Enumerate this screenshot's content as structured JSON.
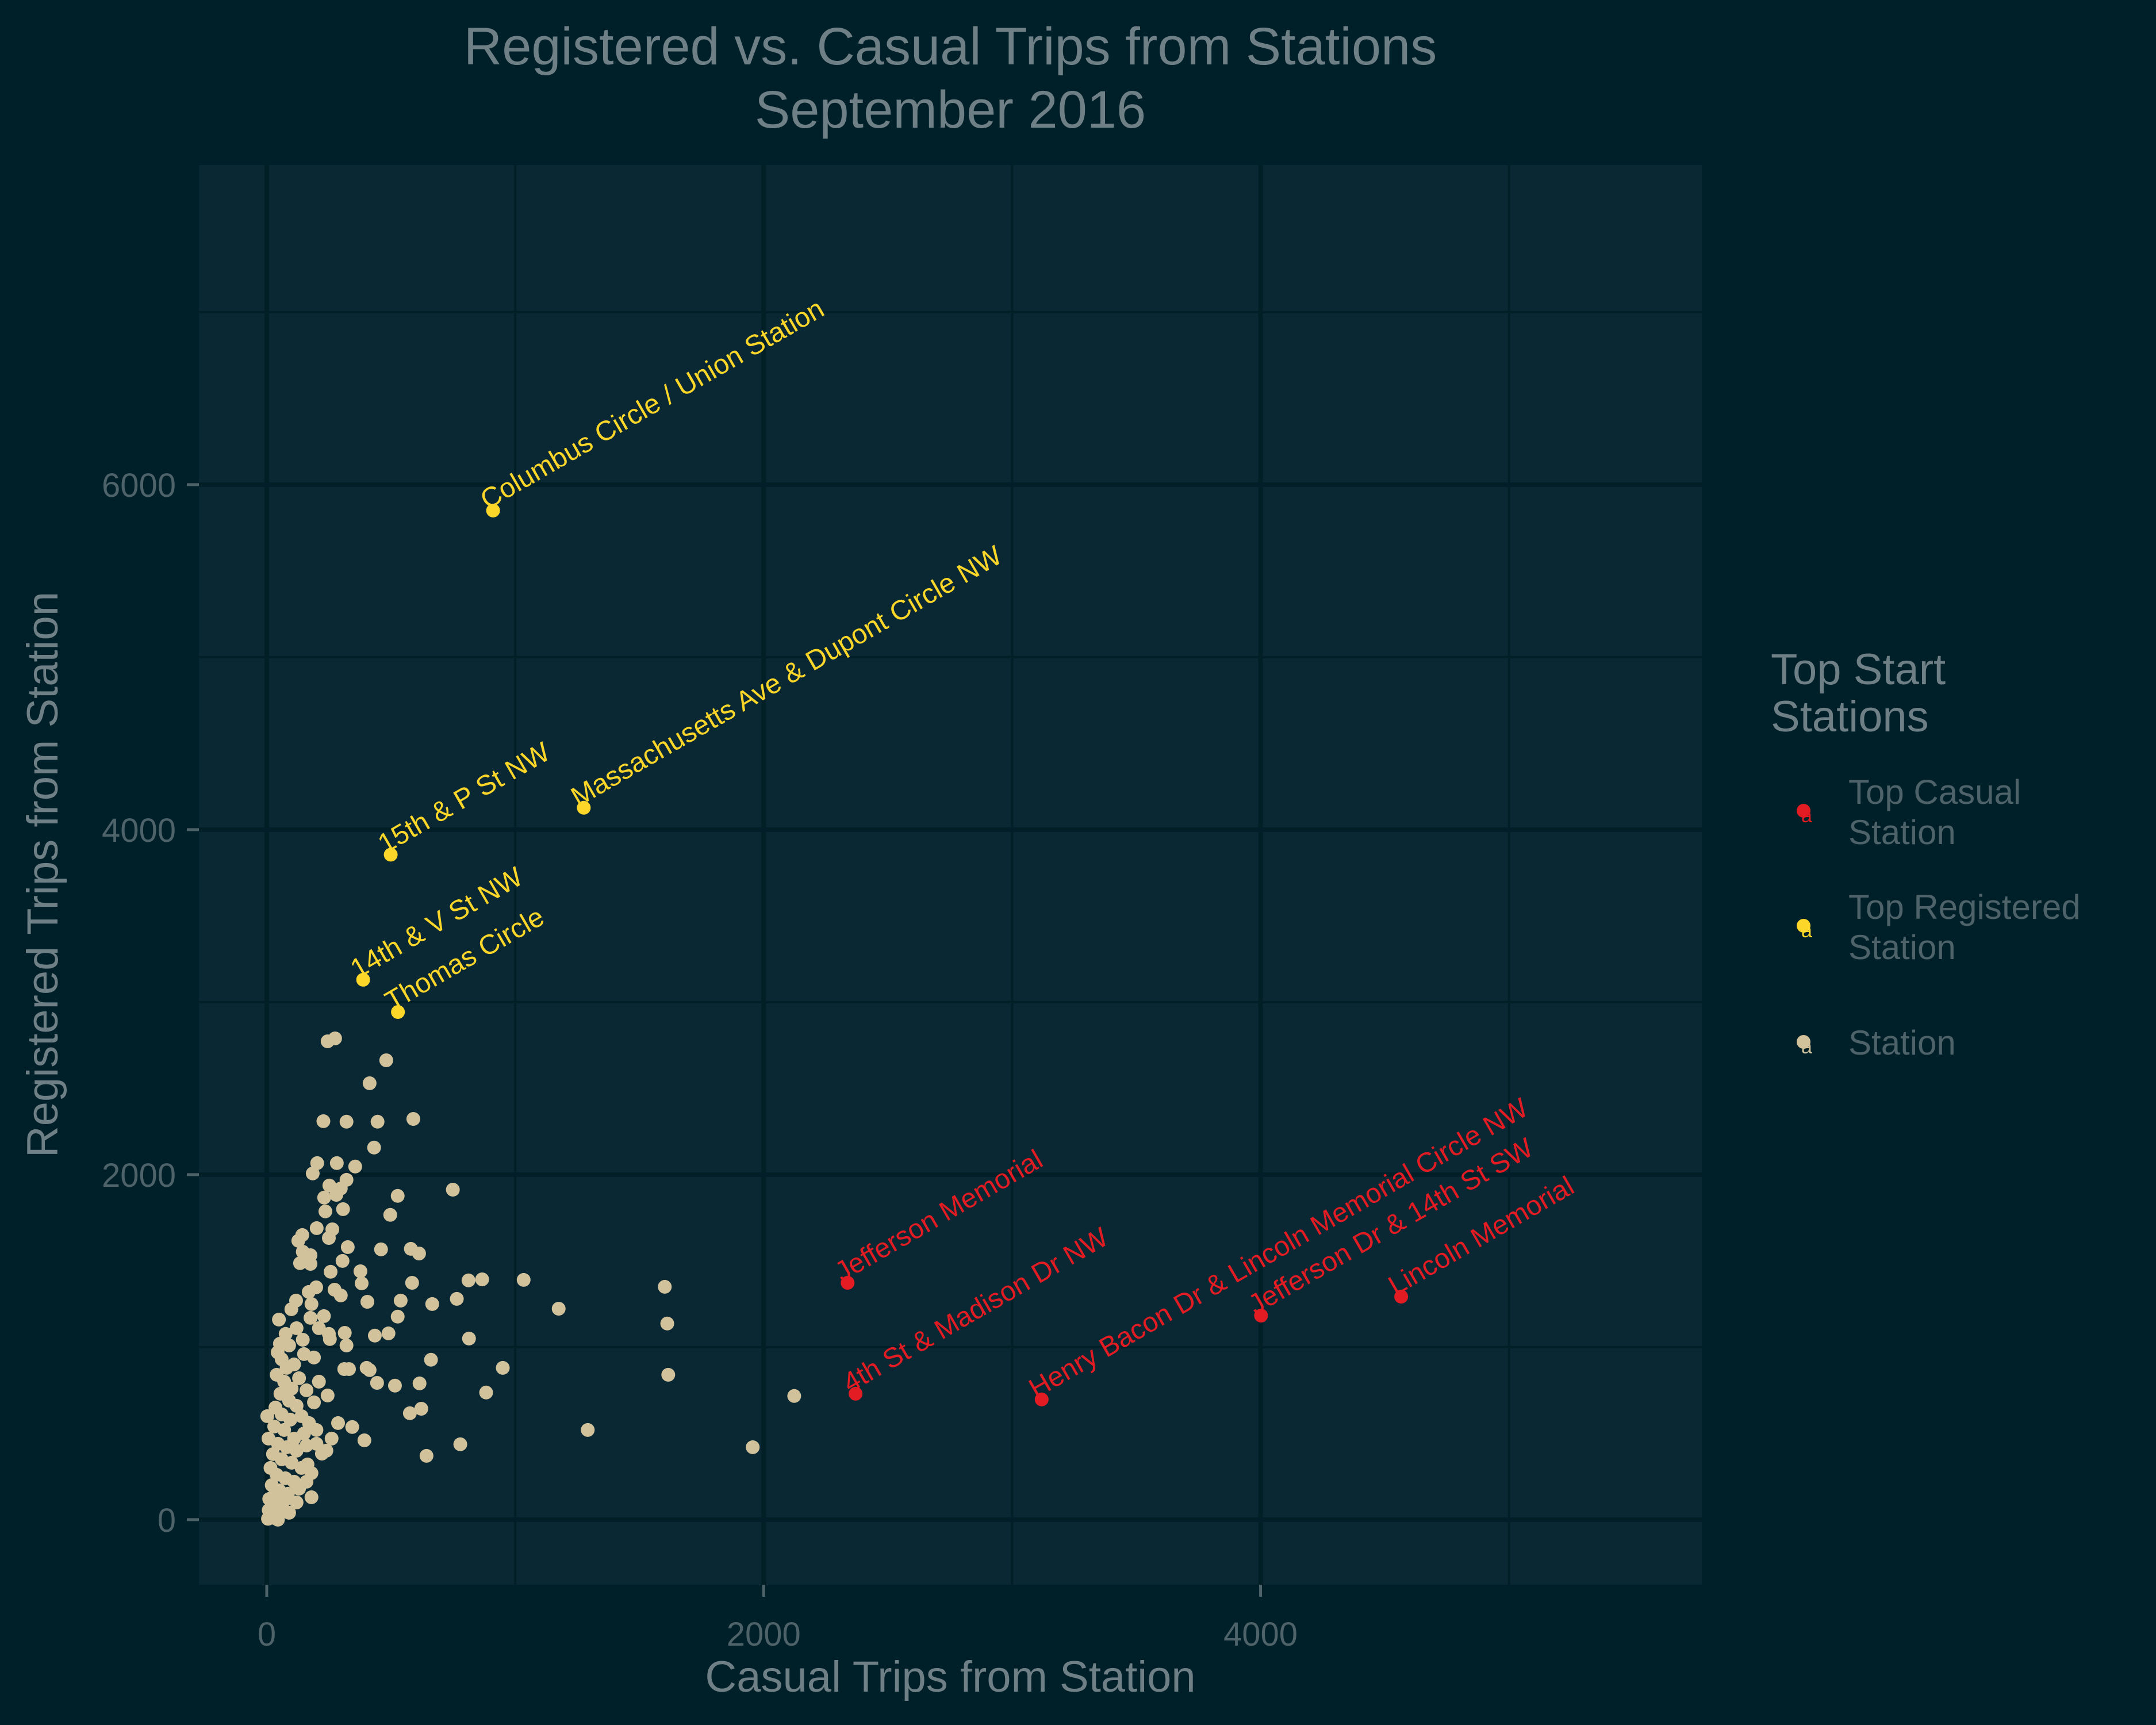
{
  "chart_data": {
    "type": "scatter",
    "title": "Registered vs. Casual Trips from Stations",
    "subtitle": "September 2016",
    "xlabel": "Casual Trips from Station",
    "ylabel": "Registered Trips from Station",
    "xlim": [
      -273,
      5776
    ],
    "ylim": [
      -377,
      7853
    ],
    "x_ticks": [
      0,
      2000,
      4000
    ],
    "y_ticks": [
      0,
      2000,
      4000,
      6000
    ],
    "x_minor_grid": [
      1000,
      3000,
      5000
    ],
    "y_minor_grid": [
      1000,
      3000,
      5000,
      7000
    ],
    "grid": true,
    "colors": {
      "background": "#002029",
      "panel": "#0a2833",
      "grid": "#021f28",
      "title_text": "#6f7f86",
      "tick_text": "#4e6269",
      "Top Casual Station": "#e31b23",
      "Top Registered Station": "#fcd72a",
      "Station": "#d2c29b"
    },
    "legend": {
      "title": "Top Start Stations",
      "title_lines": [
        "Top Start",
        "Stations"
      ],
      "position": "right",
      "entries": [
        {
          "label": "Top Casual Station",
          "lines": [
            "Top Casual",
            "Station"
          ],
          "key": "Top Casual Station"
        },
        {
          "label": "Top Registered Station",
          "lines": [
            "Top Registered",
            "Station"
          ],
          "key": "Top Registered Station"
        },
        {
          "label": "Station",
          "lines": [
            "Station"
          ],
          "key": "Station"
        }
      ]
    },
    "series": [
      {
        "name": "Top Registered Station",
        "points": [
          {
            "x": 911,
            "y": 5850,
            "label": "Columbus Circle / Union Station"
          },
          {
            "x": 1276,
            "y": 4127,
            "label": "Massachusetts Ave & Dupont Circle NW"
          },
          {
            "x": 499,
            "y": 3855,
            "label": "15th & P St NW"
          },
          {
            "x": 388,
            "y": 3130,
            "label": "14th & V St NW"
          },
          {
            "x": 528,
            "y": 2943,
            "label": "Thomas Circle"
          }
        ]
      },
      {
        "name": "Top Casual Station",
        "points": [
          {
            "x": 2338,
            "y": 1373,
            "label": "Jefferson Memorial"
          },
          {
            "x": 2370,
            "y": 730,
            "label": "4th St & Madison Dr NW"
          },
          {
            "x": 3119,
            "y": 697,
            "label": "Henry Bacon Dr & Lincoln Memorial Circle NW"
          },
          {
            "x": 4002,
            "y": 1183,
            "label": "Jefferson Dr & 14th St SW"
          },
          {
            "x": 4566,
            "y": 1293,
            "label": "Lincoln Memorial"
          }
        ]
      },
      {
        "name": "Station",
        "points": [
          {
            "x": 245,
            "y": 2773
          },
          {
            "x": 275,
            "y": 2790
          },
          {
            "x": 481,
            "y": 2663
          },
          {
            "x": 414,
            "y": 2530
          },
          {
            "x": 228,
            "y": 2310
          },
          {
            "x": 321,
            "y": 2307
          },
          {
            "x": 446,
            "y": 2307
          },
          {
            "x": 590,
            "y": 2323
          },
          {
            "x": 432,
            "y": 2157
          },
          {
            "x": 203,
            "y": 2067
          },
          {
            "x": 282,
            "y": 2067
          },
          {
            "x": 356,
            "y": 2047
          },
          {
            "x": 185,
            "y": 2007
          },
          {
            "x": 321,
            "y": 1970
          },
          {
            "x": 252,
            "y": 1937
          },
          {
            "x": 298,
            "y": 1920
          },
          {
            "x": 231,
            "y": 1867
          },
          {
            "x": 280,
            "y": 1883
          },
          {
            "x": 749,
            "y": 1913
          },
          {
            "x": 527,
            "y": 1877
          },
          {
            "x": 236,
            "y": 1787
          },
          {
            "x": 307,
            "y": 1800
          },
          {
            "x": 497,
            "y": 1767
          },
          {
            "x": 201,
            "y": 1690
          },
          {
            "x": 264,
            "y": 1683
          },
          {
            "x": 250,
            "y": 1633
          },
          {
            "x": 143,
            "y": 1650
          },
          {
            "x": 127,
            "y": 1617
          },
          {
            "x": 326,
            "y": 1580
          },
          {
            "x": 460,
            "y": 1567
          },
          {
            "x": 580,
            "y": 1570
          },
          {
            "x": 613,
            "y": 1543
          },
          {
            "x": 145,
            "y": 1553
          },
          {
            "x": 176,
            "y": 1533
          },
          {
            "x": 134,
            "y": 1487
          },
          {
            "x": 176,
            "y": 1483
          },
          {
            "x": 305,
            "y": 1500
          },
          {
            "x": 257,
            "y": 1437
          },
          {
            "x": 377,
            "y": 1440
          },
          {
            "x": 382,
            "y": 1370
          },
          {
            "x": 585,
            "y": 1373
          },
          {
            "x": 812,
            "y": 1387
          },
          {
            "x": 867,
            "y": 1393
          },
          {
            "x": 1034,
            "y": 1390
          },
          {
            "x": 1175,
            "y": 1223
          },
          {
            "x": 1602,
            "y": 1350
          },
          {
            "x": 1612,
            "y": 1137
          },
          {
            "x": 1616,
            "y": 840
          },
          {
            "x": 1292,
            "y": 520
          },
          {
            "x": 1956,
            "y": 420
          },
          {
            "x": 2123,
            "y": 717
          },
          {
            "x": 405,
            "y": 1263
          },
          {
            "x": 539,
            "y": 1270
          },
          {
            "x": 527,
            "y": 1177
          },
          {
            "x": 666,
            "y": 1250
          },
          {
            "x": 765,
            "y": 1280
          },
          {
            "x": 814,
            "y": 1050
          },
          {
            "x": 435,
            "y": 1067
          },
          {
            "x": 490,
            "y": 1080
          },
          {
            "x": 661,
            "y": 927
          },
          {
            "x": 950,
            "y": 880
          },
          {
            "x": 312,
            "y": 873
          },
          {
            "x": 331,
            "y": 873
          },
          {
            "x": 402,
            "y": 880
          },
          {
            "x": 414,
            "y": 867
          },
          {
            "x": 444,
            "y": 793
          },
          {
            "x": 516,
            "y": 777
          },
          {
            "x": 615,
            "y": 790
          },
          {
            "x": 883,
            "y": 737
          },
          {
            "x": 576,
            "y": 617
          },
          {
            "x": 622,
            "y": 643
          },
          {
            "x": 344,
            "y": 537
          },
          {
            "x": 393,
            "y": 460
          },
          {
            "x": 261,
            "y": 470
          },
          {
            "x": 779,
            "y": 437
          },
          {
            "x": 643,
            "y": 370
          },
          {
            "x": 180,
            "y": 130
          },
          {
            "x": 245,
            "y": 720
          },
          {
            "x": 287,
            "y": 560
          },
          {
            "x": 222,
            "y": 383
          },
          {
            "x": 250,
            "y": 1077
          },
          {
            "x": 314,
            "y": 1083
          },
          {
            "x": 254,
            "y": 1047
          },
          {
            "x": 321,
            "y": 1010
          },
          {
            "x": 298,
            "y": 1300
          },
          {
            "x": 273,
            "y": 1333
          },
          {
            "x": 164,
            "y": 320
          },
          {
            "x": 199,
            "y": 1347
          },
          {
            "x": 169,
            "y": 1320
          },
          {
            "x": 118,
            "y": 1270
          },
          {
            "x": 99,
            "y": 1220
          },
          {
            "x": 176,
            "y": 1170
          },
          {
            "x": 49,
            "y": 1160
          },
          {
            "x": 76,
            "y": 1077
          },
          {
            "x": 53,
            "y": 1020
          },
          {
            "x": 145,
            "y": 1043
          },
          {
            "x": 44,
            "y": 970
          },
          {
            "x": 2,
            "y": 600
          },
          {
            "x": 7,
            "y": 470
          },
          {
            "x": 60,
            "y": 930
          },
          {
            "x": 80,
            "y": 880
          },
          {
            "x": 110,
            "y": 900
          },
          {
            "x": 40,
            "y": 840
          },
          {
            "x": 70,
            "y": 800
          },
          {
            "x": 100,
            "y": 760
          },
          {
            "x": 130,
            "y": 820
          },
          {
            "x": 55,
            "y": 730
          },
          {
            "x": 90,
            "y": 690
          },
          {
            "x": 120,
            "y": 660
          },
          {
            "x": 35,
            "y": 650
          },
          {
            "x": 60,
            "y": 610
          },
          {
            "x": 95,
            "y": 580
          },
          {
            "x": 140,
            "y": 600
          },
          {
            "x": 170,
            "y": 560
          },
          {
            "x": 200,
            "y": 520
          },
          {
            "x": 150,
            "y": 500
          },
          {
            "x": 110,
            "y": 470
          },
          {
            "x": 70,
            "y": 520
          },
          {
            "x": 30,
            "y": 540
          },
          {
            "x": 45,
            "y": 440
          },
          {
            "x": 80,
            "y": 420
          },
          {
            "x": 120,
            "y": 400
          },
          {
            "x": 160,
            "y": 430
          },
          {
            "x": 200,
            "y": 440
          },
          {
            "x": 240,
            "y": 400
          },
          {
            "x": 25,
            "y": 380
          },
          {
            "x": 60,
            "y": 350
          },
          {
            "x": 100,
            "y": 330
          },
          {
            "x": 140,
            "y": 300
          },
          {
            "x": 180,
            "y": 270
          },
          {
            "x": 15,
            "y": 300
          },
          {
            "x": 40,
            "y": 260
          },
          {
            "x": 75,
            "y": 240
          },
          {
            "x": 110,
            "y": 220
          },
          {
            "x": 20,
            "y": 200
          },
          {
            "x": 50,
            "y": 170
          },
          {
            "x": 85,
            "y": 150
          },
          {
            "x": 10,
            "y": 120
          },
          {
            "x": 35,
            "y": 90
          },
          {
            "x": 60,
            "y": 60
          },
          {
            "x": 90,
            "y": 40
          },
          {
            "x": 15,
            "y": 30
          },
          {
            "x": 30,
            "y": 10
          },
          {
            "x": 5,
            "y": 5
          },
          {
            "x": 45,
            "y": 0
          },
          {
            "x": 8,
            "y": 55
          },
          {
            "x": 25,
            "y": 130
          },
          {
            "x": 120,
            "y": 100
          },
          {
            "x": 70,
            "y": 110
          },
          {
            "x": 130,
            "y": 180
          },
          {
            "x": 160,
            "y": 220
          },
          {
            "x": 190,
            "y": 680
          },
          {
            "x": 160,
            "y": 750
          },
          {
            "x": 210,
            "y": 800
          },
          {
            "x": 150,
            "y": 960
          },
          {
            "x": 190,
            "y": 940
          },
          {
            "x": 120,
            "y": 1110
          },
          {
            "x": 90,
            "y": 1010
          },
          {
            "x": 180,
            "y": 1250
          },
          {
            "x": 230,
            "y": 1180
          },
          {
            "x": 210,
            "y": 1110
          }
        ]
      }
    ]
  }
}
